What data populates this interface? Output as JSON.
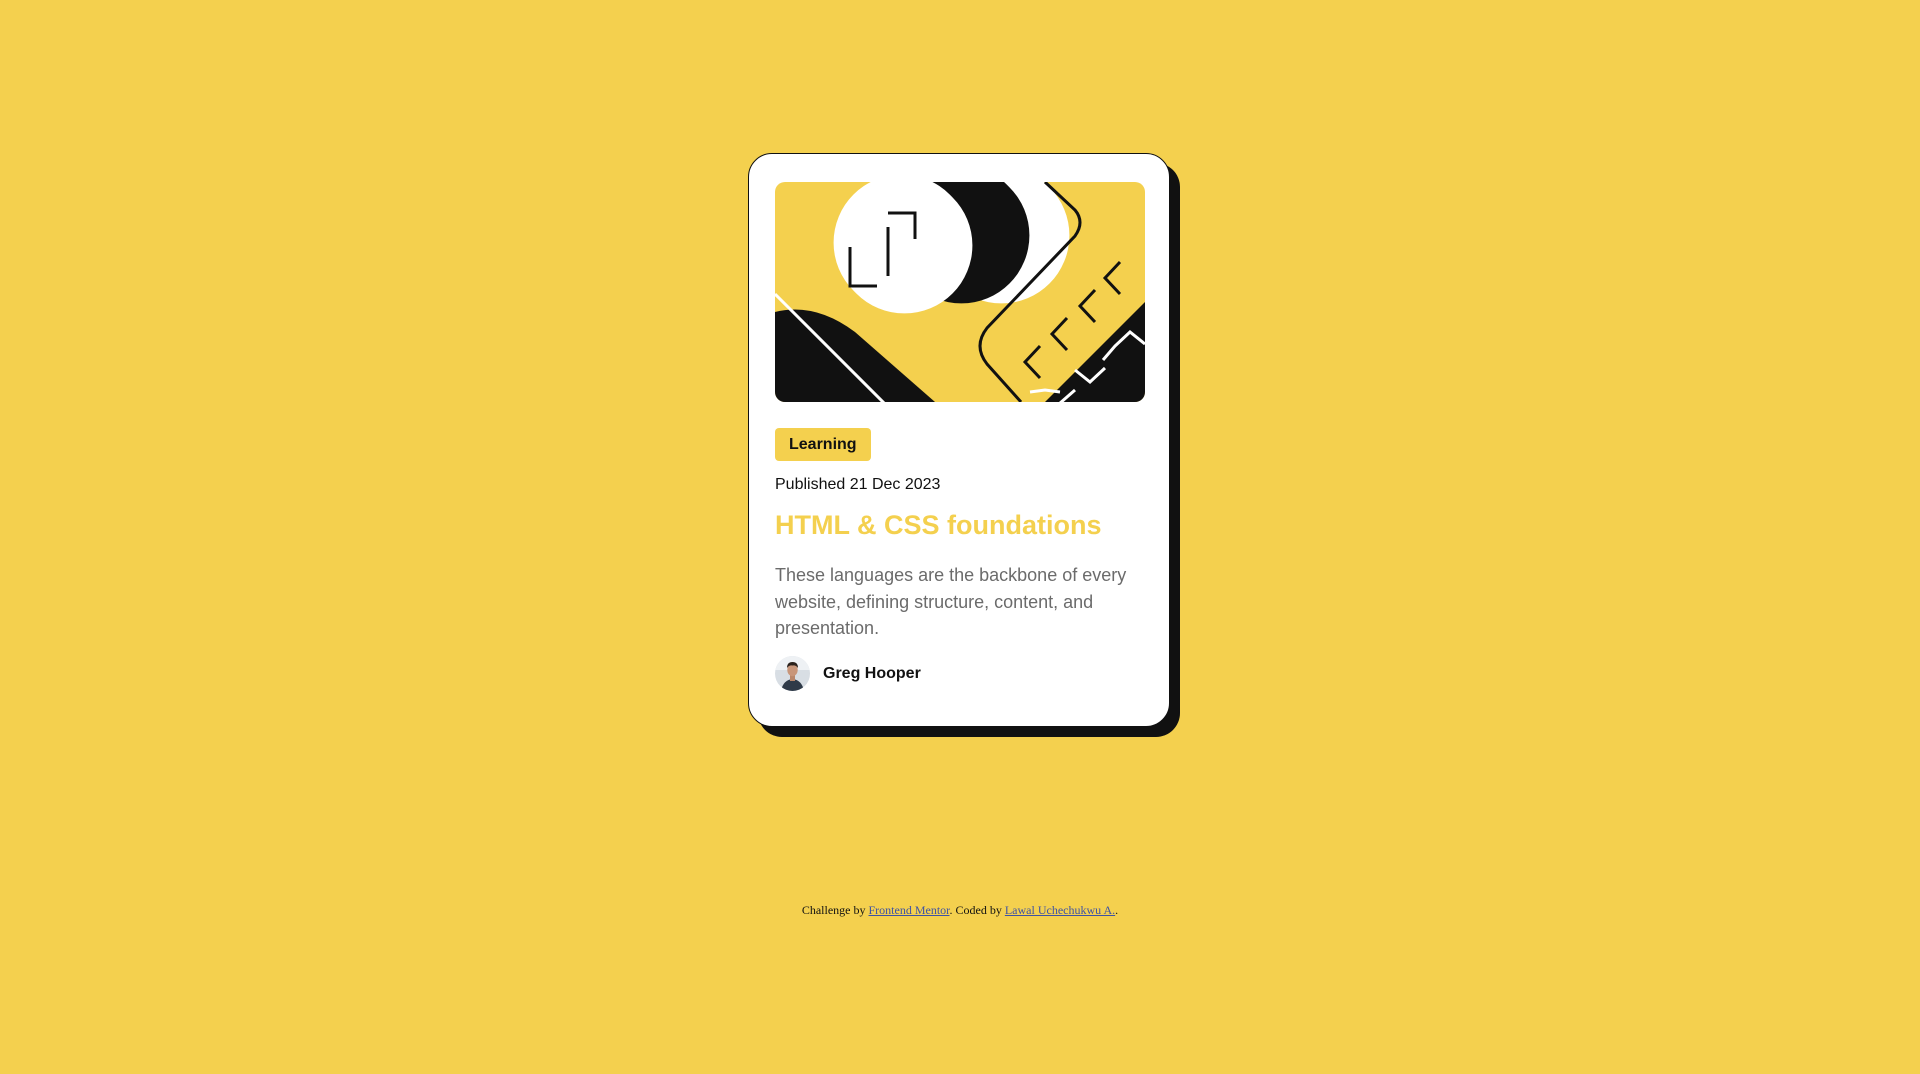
{
  "card": {
    "tag_label": "Learning",
    "published": "Published 21 Dec 2023",
    "title": "HTML & CSS foundations",
    "description": "These languages are the backbone of every website, defining structure, content, and presentation.",
    "author_name": "Greg Hooper"
  },
  "footer": {
    "challenge_prefix": "Challenge by ",
    "challenge_link": "Frontend Mentor",
    "coded_prefix": ". Coded by ",
    "coded_link": "Lawal Uchechukwu A.",
    "suffix": "."
  },
  "colors": {
    "background": "#F4D04E",
    "card": "#FFFFFF",
    "ink": "#111111",
    "muted": "#6B6B6B",
    "link": "#3E52A3"
  },
  "icons": {
    "hero": "abstract-illustration",
    "avatar": "author-avatar"
  }
}
